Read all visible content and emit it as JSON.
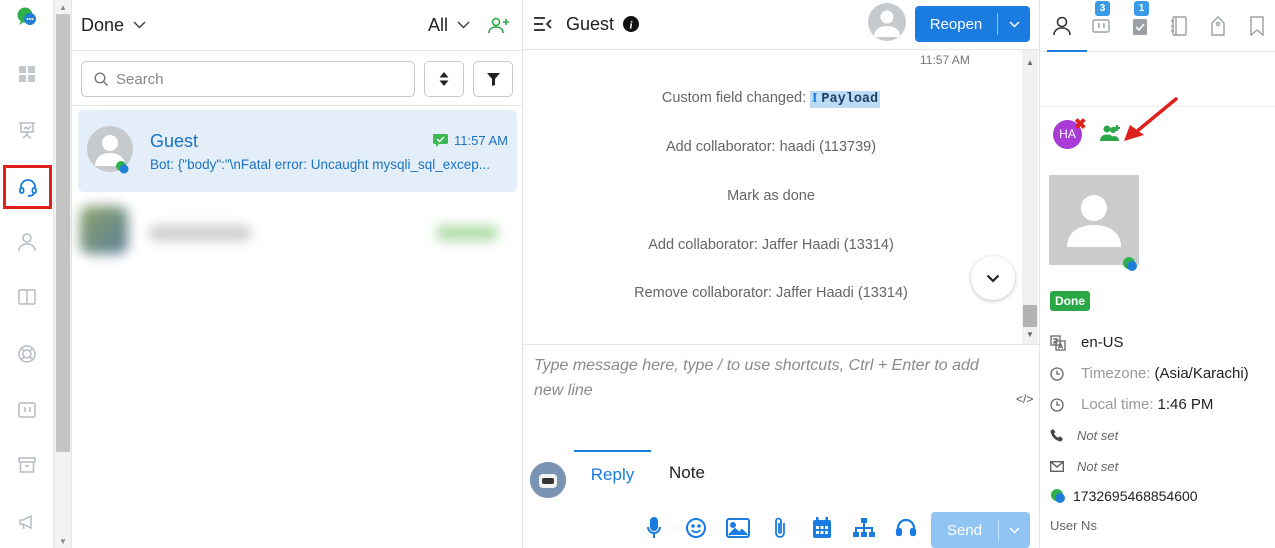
{
  "rail": {
    "items": [
      "chat-logo-icon",
      "dashboard-icon",
      "presentation-icon",
      "headset-icon",
      "user-icon",
      "columns-icon",
      "lifebuoy-icon",
      "card-icon",
      "archive-icon",
      "megaphone-icon"
    ],
    "active_item": "headset-icon",
    "highlight_color": "#e0201b"
  },
  "list": {
    "title": "Done",
    "filter": "All",
    "search": {
      "placeholder": "Search"
    },
    "conversations": [
      {
        "name": "Guest",
        "time": "11:57 AM",
        "preview": "Bot: {\"body\":\"\\nFatal error: Uncaught mysqli_sql_excep...",
        "selected": true
      }
    ]
  },
  "chat": {
    "title": "Guest",
    "reopen_label": "Reopen",
    "timestamp": "11:57 AM",
    "events": [
      {
        "prefix": "Custom field changed:",
        "tag_glyph": "I",
        "tag": "Payload"
      },
      {
        "text": "Add collaborator: haadi (113739)"
      },
      {
        "text": "Mark as done"
      },
      {
        "text": "Add collaborator: Jaffer Haadi (13314)"
      },
      {
        "text": "Remove collaborator: Jaffer Haadi (13314)"
      }
    ],
    "composer_placeholder": "Type message here, type / to use shortcuts, Ctrl + Enter to add new line",
    "code_label": "</>",
    "tabs": {
      "reply": "Reply",
      "note": "Note",
      "active": "Reply"
    },
    "toolbar_icons": [
      "microphone-icon",
      "emoji-icon",
      "image-icon",
      "paperclip-icon",
      "calendar-icon",
      "sitemap-icon",
      "headset-icon"
    ],
    "send_label": "Send",
    "accent": "#1a7ce0"
  },
  "details": {
    "tabs": [
      {
        "icon": "user-icon",
        "count": ""
      },
      {
        "icon": "card-icon",
        "count": "3"
      },
      {
        "icon": "clipboard-icon",
        "count": "1"
      },
      {
        "icon": "notebook-icon",
        "count": ""
      },
      {
        "icon": "tag-icon",
        "count": ""
      },
      {
        "icon": "bookmark-icon",
        "count": ""
      }
    ],
    "collaborator_initials": "HA",
    "status": "Done",
    "status_color": "#2aa847",
    "locale": "en-US",
    "timezone_label": "Timezone:",
    "timezone_value": "(Asia/Karachi)",
    "local_time_label": "Local time:",
    "local_time_value": "1:46 PM",
    "phone": "Not set",
    "email": "Not set",
    "whatsapp_id": "1732695468854600",
    "user_ns_label": "User Ns"
  }
}
